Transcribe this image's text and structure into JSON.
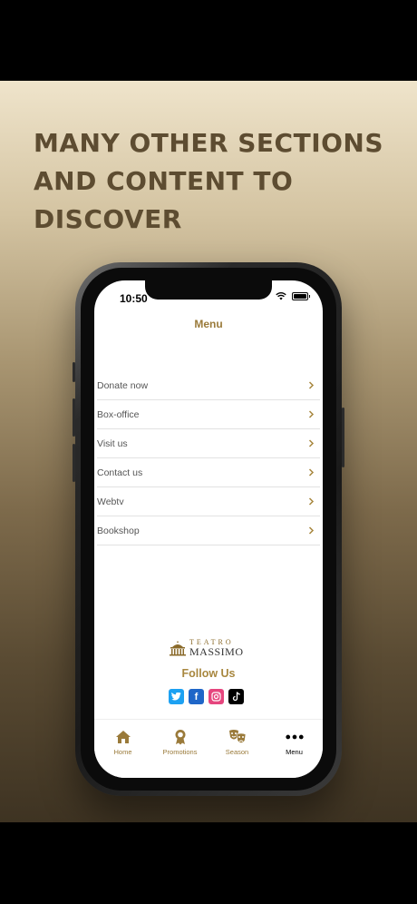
{
  "headline": {
    "line1": "MANY OTHER SECTIONS",
    "line2": "AND CONTENT TO",
    "line3": "DISCOVER"
  },
  "status": {
    "time": "10:50"
  },
  "menu": {
    "title": "Menu",
    "items": [
      {
        "label": "Donate now"
      },
      {
        "label": "Box-office"
      },
      {
        "label": "Visit us"
      },
      {
        "label": "Contact us"
      },
      {
        "label": "Webtv"
      },
      {
        "label": "Bookshop"
      }
    ]
  },
  "logo": {
    "top": "TEATRO",
    "main": "MASSIMO"
  },
  "social": {
    "title": "Follow Us",
    "icons": [
      "twitter-icon",
      "facebook-icon",
      "instagram-icon",
      "tiktok-icon"
    ]
  },
  "tabbar": {
    "tabs": [
      {
        "label": "Home",
        "icon": "home-icon"
      },
      {
        "label": "Promotions",
        "icon": "award-icon"
      },
      {
        "label": "Season",
        "icon": "theater-masks-icon"
      },
      {
        "label": "Menu",
        "icon": "more-dots-icon",
        "active": true
      }
    ]
  },
  "colors": {
    "accent": "#9a7a3a",
    "headline": "#5d4c31"
  }
}
